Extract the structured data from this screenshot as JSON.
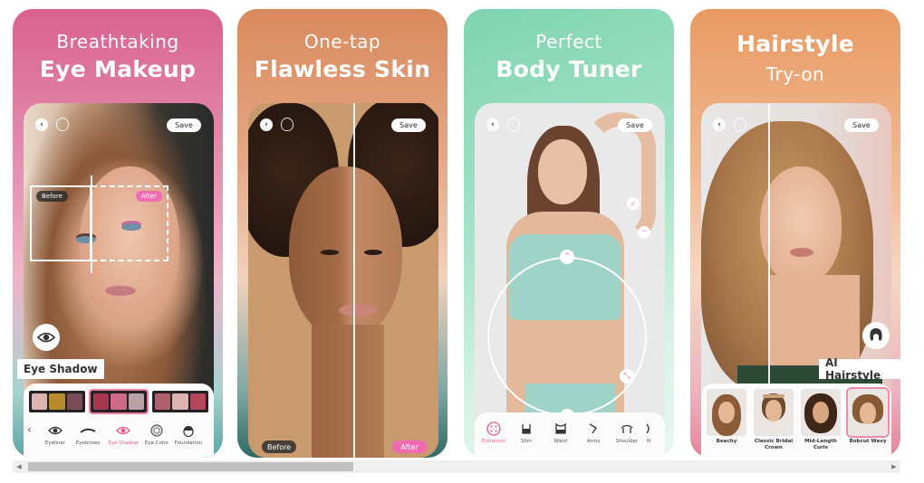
{
  "cards": [
    {
      "headline_light": "Breathtaking",
      "headline_bold": "Eye Makeup",
      "save_label": "Save",
      "before_label": "Before",
      "after_label": "After",
      "feature_tag": "Eye Shadow",
      "feature_icon": "eye-icon",
      "tools": [
        {
          "label": "Eyeliner",
          "icon": "eye-icon",
          "active": false
        },
        {
          "label": "Eyebrows",
          "icon": "eyebrow-icon",
          "active": false
        },
        {
          "label": "Eye Shadow",
          "icon": "eye-icon",
          "active": true
        },
        {
          "label": "Eye Color",
          "icon": "iris-icon",
          "active": false
        },
        {
          "label": "Foundation",
          "icon": "face-icon",
          "active": false
        }
      ],
      "palettes": [
        {
          "colors": [
            "#dcb4b0",
            "#b98a2c",
            "#7a4a57"
          ],
          "selected": false
        },
        {
          "colors": [
            "#a8364e",
            "#cf6a86",
            "#b8a2a8"
          ],
          "selected": true
        },
        {
          "colors": [
            "#b15e6c",
            "#dbb3b3",
            "#b4465a"
          ],
          "selected": false
        }
      ]
    },
    {
      "headline_light": "One-tap",
      "headline_bold": "Flawless Skin",
      "save_label": "Save",
      "before_label": "Before",
      "after_label": "After"
    },
    {
      "headline_light": "Perfect",
      "headline_bold": "Body Tuner",
      "save_label": "Save",
      "tools": [
        {
          "label": "Enhancer",
          "icon": "enhancer-icon",
          "active": true
        },
        {
          "label": "Slim",
          "icon": "slim-icon",
          "active": false
        },
        {
          "label": "Waist",
          "icon": "waist-icon",
          "active": false
        },
        {
          "label": "Arms",
          "icon": "arms-icon",
          "active": false
        },
        {
          "label": "Shoulder",
          "icon": "shoulder-icon",
          "active": false
        },
        {
          "label": "N",
          "icon": "neck-icon",
          "active": false
        }
      ]
    },
    {
      "headline_bold": "Hairstyle",
      "headline_light": "Try-on",
      "save_label": "Save",
      "feature_tag": "AI Hairstyle",
      "feature_icon": "hairstyle-icon",
      "hairstyles": [
        {
          "label": "Beachy",
          "selected": false
        },
        {
          "label": "Classic Bridal Crown",
          "selected": false
        },
        {
          "label": "Mid-Length Curls",
          "selected": false
        },
        {
          "label": "Bobcut Wavy",
          "selected": true
        }
      ]
    }
  ],
  "scrollbar": {
    "left_arrow": "◀",
    "right_arrow": "▶",
    "position_fraction": 0.0,
    "visible_fraction": 0.38
  },
  "colors": {
    "accent_pink": "#f06bb2",
    "eye_theme": "#d9628f",
    "skin_theme": "#d98a5d",
    "body_theme": "#7fd4b0",
    "hair_theme": "#e99a63"
  }
}
